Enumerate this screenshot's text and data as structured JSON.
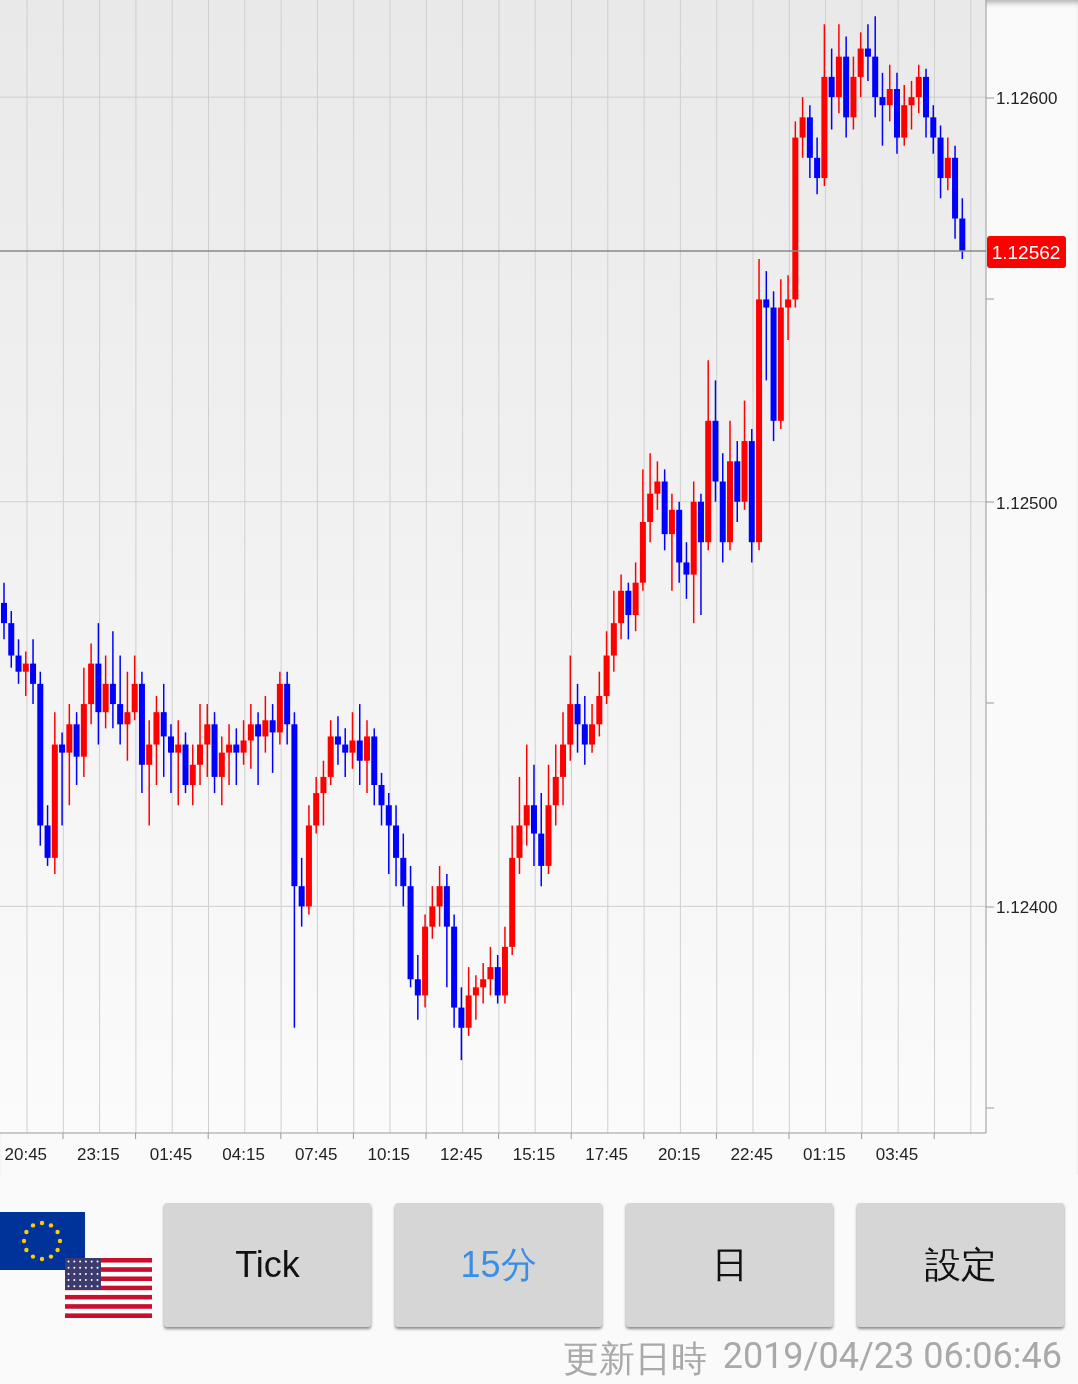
{
  "chart": {
    "chart_data": {
      "type": "candlestick",
      "grid": true,
      "categories": [
        null,
        null,
        null,
        "20:45",
        null,
        null,
        null,
        null,
        null,
        null,
        null,
        null,
        null,
        "23:15",
        null,
        null,
        null,
        null,
        null,
        null,
        null,
        null,
        null,
        "01:45",
        null,
        null,
        null,
        null,
        null,
        null,
        null,
        null,
        null,
        "04:15",
        null,
        null,
        null,
        null,
        null,
        null,
        null,
        null,
        null,
        "07:45",
        null,
        null,
        null,
        null,
        null,
        null,
        null,
        null,
        null,
        "10:15",
        null,
        null,
        null,
        null,
        null,
        null,
        null,
        null,
        null,
        "12:45",
        null,
        null,
        null,
        null,
        null,
        null,
        null,
        null,
        null,
        "15:15",
        null,
        null,
        null,
        null,
        null,
        null,
        null,
        null,
        null,
        "17:45",
        null,
        null,
        null,
        null,
        null,
        null,
        null,
        null,
        null,
        "20:15",
        null,
        null,
        null,
        null,
        null,
        null,
        null,
        null,
        null,
        "22:45",
        null,
        null,
        null,
        null,
        null,
        null,
        null,
        null,
        null,
        "01:15",
        null,
        null,
        null,
        null,
        null,
        null,
        null,
        null,
        null,
        "03:45",
        null,
        null,
        null,
        null,
        null,
        null,
        null,
        null,
        null
      ],
      "ylim": [
        1.12344,
        1.12624
      ],
      "ref_lines": [
        {
          "axis": "y",
          "value": 1.12562,
          "label": "1.12562"
        }
      ],
      "yticks": [
        {
          "value": 1.126,
          "label": "1.12600"
        },
        {
          "value": 1.125,
          "label": "1.12500"
        },
        {
          "value": 1.124,
          "label": "1.12400"
        }
      ],
      "ohlc": [
        [
          1.12475,
          1.1248,
          1.12466,
          1.1247
        ],
        [
          1.1247,
          1.12473,
          1.12459,
          1.12462
        ],
        [
          1.12462,
          1.12466,
          1.12455,
          1.12458
        ],
        [
          1.12458,
          1.12463,
          1.12452,
          1.1246
        ],
        [
          1.1246,
          1.12466,
          1.1245,
          1.12455
        ],
        [
          1.12455,
          1.12458,
          1.12415,
          1.1242
        ],
        [
          1.1242,
          1.12425,
          1.1241,
          1.12412
        ],
        [
          1.12412,
          1.12448,
          1.12408,
          1.1244
        ],
        [
          1.1244,
          1.12443,
          1.1242,
          1.12438
        ],
        [
          1.12438,
          1.1245,
          1.12425,
          1.12445
        ],
        [
          1.12445,
          1.12448,
          1.1243,
          1.12437
        ],
        [
          1.12437,
          1.12459,
          1.12432,
          1.1245
        ],
        [
          1.1245,
          1.12465,
          1.12445,
          1.1246
        ],
        [
          1.1246,
          1.1247,
          1.1244,
          1.12448
        ],
        [
          1.12448,
          1.12462,
          1.12444,
          1.12455
        ],
        [
          1.12455,
          1.12468,
          1.12444,
          1.1245
        ],
        [
          1.1245,
          1.12462,
          1.1244,
          1.12445
        ],
        [
          1.12445,
          1.12458,
          1.12436,
          1.12448
        ],
        [
          1.12448,
          1.12462,
          1.12446,
          1.12455
        ],
        [
          1.12455,
          1.12458,
          1.12428,
          1.12435
        ],
        [
          1.12435,
          1.12446,
          1.1242,
          1.1244
        ],
        [
          1.1244,
          1.12452,
          1.1243,
          1.12448
        ],
        [
          1.12448,
          1.12455,
          1.12432,
          1.12442
        ],
        [
          1.12442,
          1.12445,
          1.12428,
          1.12438
        ],
        [
          1.12438,
          1.12446,
          1.12425,
          1.1244
        ],
        [
          1.1244,
          1.12443,
          1.12428,
          1.1243
        ],
        [
          1.1243,
          1.1244,
          1.12425,
          1.12435
        ],
        [
          1.12435,
          1.1245,
          1.1243,
          1.1244
        ],
        [
          1.1244,
          1.1245,
          1.12432,
          1.12445
        ],
        [
          1.12445,
          1.12448,
          1.12428,
          1.12432
        ],
        [
          1.12432,
          1.12442,
          1.12425,
          1.12438
        ],
        [
          1.12438,
          1.12445,
          1.1243,
          1.1244
        ],
        [
          1.1244,
          1.12444,
          1.1243,
          1.12438
        ],
        [
          1.12438,
          1.12446,
          1.12435,
          1.12441
        ],
        [
          1.12441,
          1.1245,
          1.12434,
          1.12445
        ],
        [
          1.12445,
          1.12448,
          1.1243,
          1.12442
        ],
        [
          1.12442,
          1.12452,
          1.12438,
          1.12446
        ],
        [
          1.12446,
          1.1245,
          1.12433,
          1.12443
        ],
        [
          1.12443,
          1.12458,
          1.1244,
          1.12455
        ],
        [
          1.12455,
          1.12458,
          1.1244,
          1.12445
        ],
        [
          1.12445,
          1.12448,
          1.1237,
          1.12405
        ],
        [
          1.12405,
          1.12412,
          1.12395,
          1.124
        ],
        [
          1.124,
          1.12425,
          1.12398,
          1.1242
        ],
        [
          1.1242,
          1.12432,
          1.12418,
          1.12428
        ],
        [
          1.12428,
          1.12436,
          1.1242,
          1.12432
        ],
        [
          1.12432,
          1.12446,
          1.1243,
          1.12442
        ],
        [
          1.12442,
          1.12447,
          1.12435,
          1.1244
        ],
        [
          1.1244,
          1.12444,
          1.12432,
          1.12438
        ],
        [
          1.12438,
          1.12448,
          1.12434,
          1.12441
        ],
        [
          1.12441,
          1.1245,
          1.1243,
          1.12436
        ],
        [
          1.12436,
          1.12446,
          1.12428,
          1.12442
        ],
        [
          1.12442,
          1.12444,
          1.12425,
          1.1243
        ],
        [
          1.1243,
          1.12433,
          1.1242,
          1.12425
        ],
        [
          1.12425,
          1.12428,
          1.12408,
          1.1242
        ],
        [
          1.1242,
          1.12425,
          1.12405,
          1.12412
        ],
        [
          1.12412,
          1.12418,
          1.124,
          1.12405
        ],
        [
          1.12405,
          1.1241,
          1.1238,
          1.12382
        ],
        [
          1.12382,
          1.12388,
          1.12372,
          1.12378
        ],
        [
          1.12378,
          1.12398,
          1.12375,
          1.12395
        ],
        [
          1.12395,
          1.12405,
          1.12392,
          1.124
        ],
        [
          1.124,
          1.1241,
          1.12395,
          1.12405
        ],
        [
          1.12405,
          1.12408,
          1.1238,
          1.12395
        ],
        [
          1.12395,
          1.12398,
          1.1237,
          1.12375
        ],
        [
          1.12375,
          1.1238,
          1.12362,
          1.1237
        ],
        [
          1.1237,
          1.12385,
          1.12368,
          1.12378
        ],
        [
          1.12378,
          1.12383,
          1.12372,
          1.1238
        ],
        [
          1.1238,
          1.12386,
          1.12376,
          1.12382
        ],
        [
          1.12382,
          1.1239,
          1.12378,
          1.12385
        ],
        [
          1.12385,
          1.12388,
          1.12376,
          1.12378
        ],
        [
          1.12378,
          1.12395,
          1.12376,
          1.1239
        ],
        [
          1.1239,
          1.1242,
          1.12388,
          1.12412
        ],
        [
          1.12412,
          1.12432,
          1.12408,
          1.1242
        ],
        [
          1.1242,
          1.1244,
          1.12415,
          1.12425
        ],
        [
          1.12425,
          1.12435,
          1.1241,
          1.12418
        ],
        [
          1.12418,
          1.12428,
          1.12405,
          1.1241
        ],
        [
          1.1241,
          1.12435,
          1.12408,
          1.12425
        ],
        [
          1.12425,
          1.1244,
          1.1242,
          1.12432
        ],
        [
          1.12432,
          1.12448,
          1.12425,
          1.1244
        ],
        [
          1.1244,
          1.12462,
          1.12436,
          1.1245
        ],
        [
          1.1245,
          1.12455,
          1.12438,
          1.12445
        ],
        [
          1.12445,
          1.12452,
          1.12435,
          1.1244
        ],
        [
          1.1244,
          1.1245,
          1.12438,
          1.12445
        ],
        [
          1.12445,
          1.12458,
          1.12442,
          1.12452
        ],
        [
          1.12452,
          1.12468,
          1.1245,
          1.12462
        ],
        [
          1.12462,
          1.12478,
          1.12458,
          1.1247
        ],
        [
          1.1247,
          1.12482,
          1.12466,
          1.12478
        ],
        [
          1.12478,
          1.1248,
          1.12466,
          1.12472
        ],
        [
          1.12472,
          1.12485,
          1.12468,
          1.1248
        ],
        [
          1.1248,
          1.12508,
          1.12478,
          1.12495
        ],
        [
          1.12495,
          1.12512,
          1.1249,
          1.12502
        ],
        [
          1.12502,
          1.1251,
          1.12498,
          1.12505
        ],
        [
          1.12505,
          1.12508,
          1.12488,
          1.12492
        ],
        [
          1.12492,
          1.12502,
          1.12478,
          1.12498
        ],
        [
          1.12498,
          1.125,
          1.1248,
          1.12485
        ],
        [
          1.12485,
          1.1249,
          1.12476,
          1.12482
        ],
        [
          1.12482,
          1.12505,
          1.1247,
          1.125
        ],
        [
          1.125,
          1.12502,
          1.12472,
          1.1249
        ],
        [
          1.1249,
          1.12535,
          1.12488,
          1.1252
        ],
        [
          1.1252,
          1.1253,
          1.125,
          1.12505
        ],
        [
          1.12505,
          1.12512,
          1.12485,
          1.1249
        ],
        [
          1.1249,
          1.1252,
          1.12488,
          1.1251
        ],
        [
          1.1251,
          1.12515,
          1.12495,
          1.125
        ],
        [
          1.125,
          1.12525,
          1.12498,
          1.12515
        ],
        [
          1.12515,
          1.12518,
          1.12485,
          1.1249
        ],
        [
          1.1249,
          1.1256,
          1.12488,
          1.1255
        ],
        [
          1.1255,
          1.12557,
          1.1253,
          1.12548
        ],
        [
          1.12548,
          1.12552,
          1.12515,
          1.1252
        ],
        [
          1.1252,
          1.12555,
          1.12518,
          1.12548
        ],
        [
          1.12548,
          1.12556,
          1.1254,
          1.1255
        ],
        [
          1.1255,
          1.12594,
          1.12548,
          1.1259
        ],
        [
          1.1259,
          1.126,
          1.12585,
          1.12595
        ],
        [
          1.12595,
          1.12598,
          1.1258,
          1.12585
        ],
        [
          1.12585,
          1.1259,
          1.12576,
          1.1258
        ],
        [
          1.1258,
          1.12618,
          1.12578,
          1.12605
        ],
        [
          1.12605,
          1.12612,
          1.12592,
          1.126
        ],
        [
          1.126,
          1.12618,
          1.12596,
          1.1261
        ],
        [
          1.1261,
          1.12615,
          1.1259,
          1.12595
        ],
        [
          1.12595,
          1.1261,
          1.12592,
          1.12605
        ],
        [
          1.12605,
          1.12616,
          1.126,
          1.12612
        ],
        [
          1.12612,
          1.12618,
          1.12604,
          1.1261
        ],
        [
          1.1261,
          1.1262,
          1.12595,
          1.126
        ],
        [
          1.126,
          1.12606,
          1.12588,
          1.12598
        ],
        [
          1.12598,
          1.12608,
          1.12594,
          1.12602
        ],
        [
          1.12602,
          1.12606,
          1.12586,
          1.1259
        ],
        [
          1.1259,
          1.12603,
          1.12588,
          1.12598
        ],
        [
          1.12598,
          1.12604,
          1.12592,
          1.126
        ],
        [
          1.126,
          1.12608,
          1.12596,
          1.12605
        ],
        [
          1.12605,
          1.12607,
          1.1259,
          1.12595
        ],
        [
          1.12595,
          1.12598,
          1.12586,
          1.1259
        ],
        [
          1.1259,
          1.12593,
          1.12575,
          1.1258
        ],
        [
          1.1258,
          1.1259,
          1.12577,
          1.12585
        ],
        [
          1.12585,
          1.12588,
          1.12565,
          1.1257
        ],
        [
          1.1257,
          1.12575,
          1.1256,
          1.12562
        ]
      ]
    }
  },
  "buttons": [
    {
      "label": "Tick",
      "selected": false
    },
    {
      "label": "15分",
      "selected": true
    },
    {
      "label": "日",
      "selected": false
    },
    {
      "label": "設定",
      "selected": false
    }
  ],
  "updated": {
    "label": "更新日時",
    "value": "2019/04/23 06:06:46"
  }
}
